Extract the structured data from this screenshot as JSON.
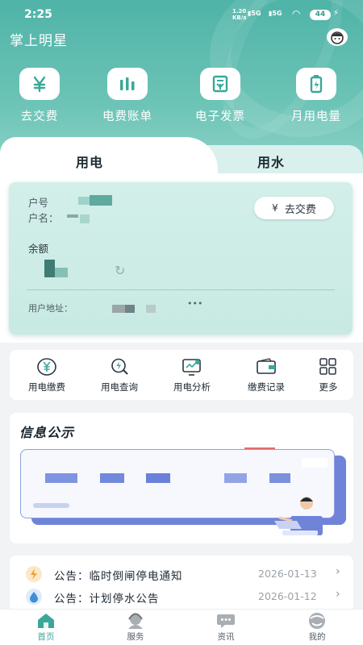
{
  "status_bar": {
    "time": "2:25",
    "net_speed_value": "1.20",
    "net_speed_unit": "KB/s",
    "signal1": "5G",
    "signal2": "5G",
    "battery": "44"
  },
  "app": {
    "title": "掌上明星"
  },
  "quick_actions": [
    {
      "label": "去交费",
      "icon": "yuan-icon"
    },
    {
      "label": "电费账单",
      "icon": "bar-chart-icon"
    },
    {
      "label": "电子发票",
      "icon": "invoice-icon"
    },
    {
      "label": "月用电量",
      "icon": "battery-charge-icon"
    }
  ],
  "tabs": [
    {
      "label": "用电",
      "active": true
    },
    {
      "label": "用水",
      "active": false
    }
  ],
  "account_card": {
    "account_no_label": "户号",
    "name_label": "户名：",
    "pay_button": "去交费",
    "balance_label": "余额",
    "address_label": "用户地址：",
    "address_dots": "•••"
  },
  "services": [
    {
      "label": "用电缴费",
      "icon": "yuan-circle-icon"
    },
    {
      "label": "用电查询",
      "icon": "search-bolt-icon"
    },
    {
      "label": "用电分析",
      "icon": "monitor-chart-icon"
    },
    {
      "label": "缴费记录",
      "icon": "wallet-icon"
    },
    {
      "label": "更多",
      "icon": "grid-icon"
    }
  ],
  "info_section": {
    "title": "信息公示"
  },
  "notices": [
    {
      "text": "公告：临时倒闸停电通知",
      "date": "2026-01-13",
      "icon": "lightning-icon"
    },
    {
      "text": "公告：计划停水公告",
      "date": "2026-01-12",
      "icon": "water-drop-icon"
    }
  ],
  "bottom_nav": [
    {
      "label": "首页",
      "icon": "home-icon",
      "active": true
    },
    {
      "label": "服务",
      "icon": "service-icon",
      "active": false
    },
    {
      "label": "资讯",
      "icon": "chat-icon",
      "active": false
    },
    {
      "label": "我的",
      "icon": "profile-icon",
      "active": false
    }
  ],
  "colors": {
    "brand": "#4fb3a7",
    "card": "#d3efe9",
    "active_nav": "#3aa899",
    "board_accent": "#6f84d8"
  }
}
